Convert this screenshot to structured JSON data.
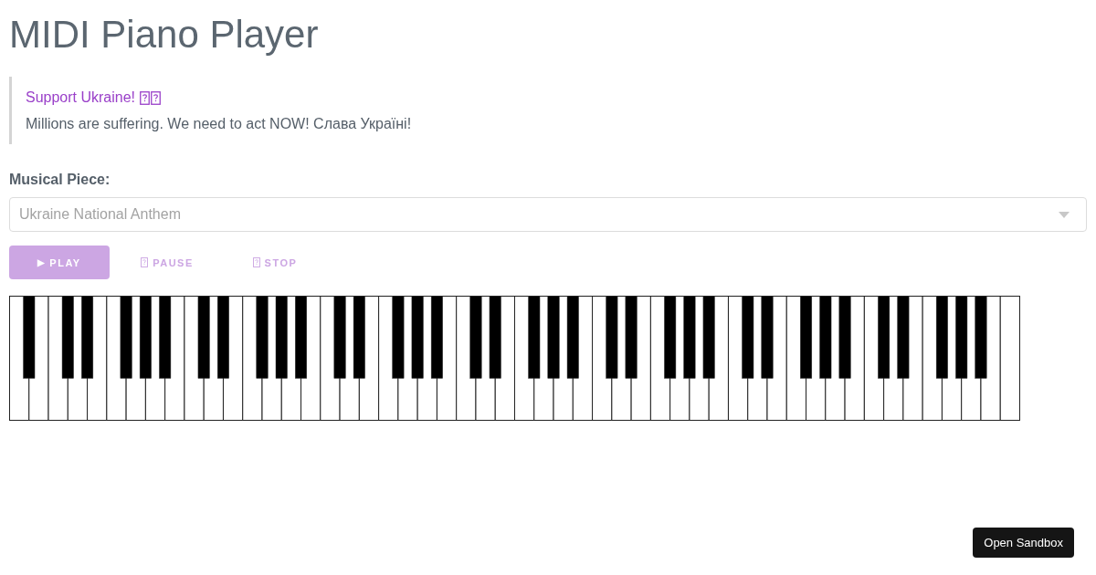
{
  "title": "MIDI Piano Player",
  "notice": {
    "heading": "Support Ukraine!",
    "heading_icons": [
      {
        "kind": "missing-glyph"
      },
      {
        "kind": "missing-glyph"
      }
    ],
    "message": "Millions are suffering. We need to act NOW! Слава Україні!"
  },
  "piece_select": {
    "label": "Musical Piece:",
    "value": "Ukraine National Anthem"
  },
  "controls": [
    {
      "label": "PLAY",
      "kind": "contained",
      "icon": {
        "kind": "glyph",
        "text": "▶"
      }
    },
    {
      "label": "PAUSE",
      "kind": "text",
      "icon": {
        "kind": "missing-glyph"
      }
    },
    {
      "label": "STOP",
      "kind": "text",
      "icon": {
        "kind": "missing-glyph"
      }
    }
  ],
  "sandbox_button": {
    "label": "Open Sandbox"
  }
}
